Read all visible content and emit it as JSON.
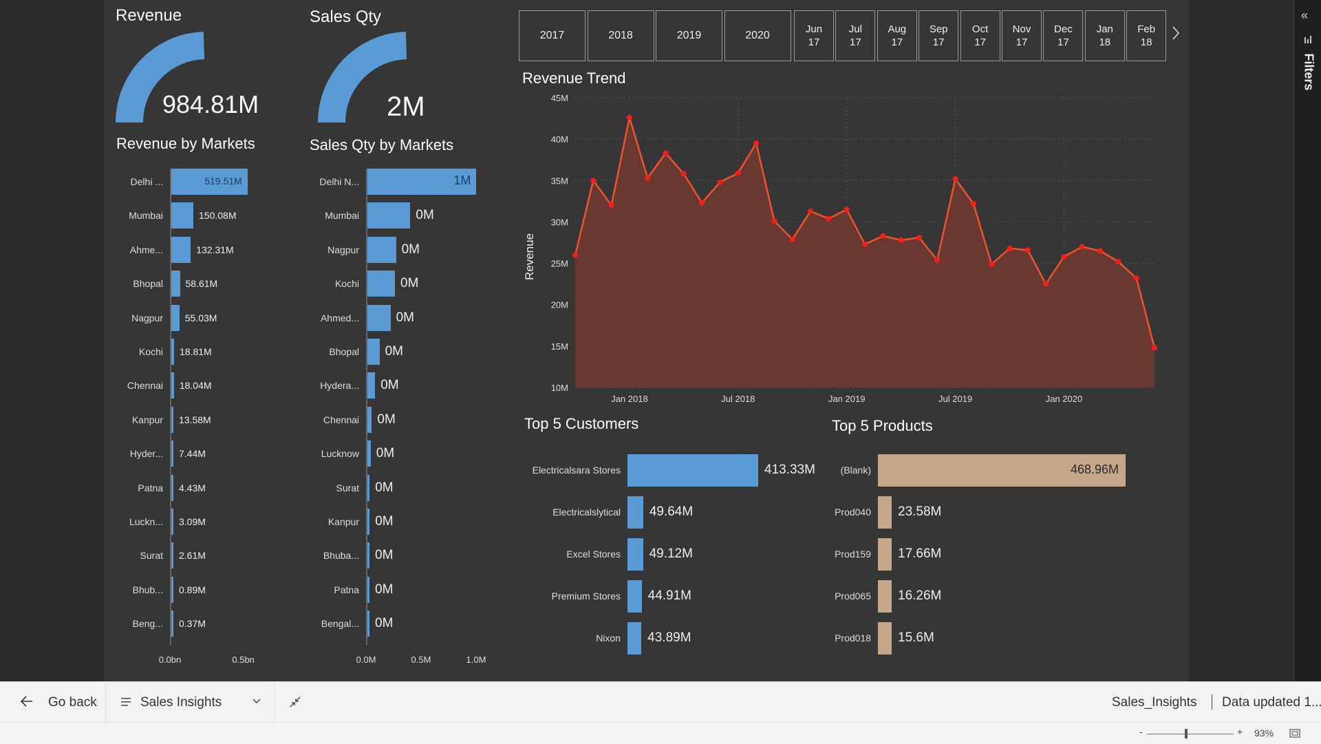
{
  "cards": {
    "revenue": {
      "title": "Revenue",
      "value": "984.81M",
      "fill": 0.98
    },
    "sales_qty": {
      "title": "Sales Qty",
      "value": "2M",
      "fill": 0.98
    }
  },
  "revenue_by_markets": {
    "title": "Revenue by Markets",
    "labels": [
      "Delhi ...",
      "Mumbai",
      "Ahme...",
      "Bhopal",
      "Nagpur",
      "Kochi",
      "Chennai",
      "Kanpur",
      "Hyder...",
      "Patna",
      "Luckn...",
      "Surat",
      "Bhub...",
      "Beng..."
    ],
    "value_labels": [
      "519.51M",
      "150.08M",
      "132.31M",
      "58.61M",
      "55.03M",
      "18.81M",
      "18.04M",
      "13.58M",
      "7.44M",
      "4.43M",
      "3.09M",
      "2.61M",
      "0.89M",
      "0.37M"
    ],
    "axis_ticks": [
      "0.0bn",
      "0.5bn"
    ]
  },
  "sales_qty_by_markets": {
    "title": "Sales Qty by Markets",
    "labels": [
      "Delhi N...",
      "Mumbai",
      "Nagpur",
      "Kochi",
      "Ahmed...",
      "Bhopal",
      "Hydera...",
      "Chennai",
      "Lucknow",
      "Surat",
      "Kanpur",
      "Bhuba...",
      "Patna",
      "Bengal..."
    ],
    "value_labels": [
      "1M",
      "0M",
      "0M",
      "0M",
      "0M",
      "0M",
      "0M",
      "0M",
      "0M",
      "0M",
      "0M",
      "0M",
      "0M",
      "0M"
    ],
    "axis_ticks": [
      "0.0M",
      "0.5M",
      "1.0M"
    ]
  },
  "slicer": {
    "years": [
      "2017",
      "2018",
      "2019",
      "2020"
    ],
    "months": [
      {
        "month": "Jun",
        "year": "17"
      },
      {
        "month": "Jul",
        "year": "17"
      },
      {
        "month": "Aug",
        "year": "17"
      },
      {
        "month": "Sep",
        "year": "17"
      },
      {
        "month": "Oct",
        "year": "17"
      },
      {
        "month": "Nov",
        "year": "17"
      },
      {
        "month": "Dec",
        "year": "17"
      },
      {
        "month": "Jan",
        "year": "18"
      },
      {
        "month": "Feb",
        "year": "18"
      }
    ],
    "next_icon": "chevron-right-icon"
  },
  "revenue_trend": {
    "title": "Revenue Trend",
    "ylabel": "Revenue",
    "y_ticks": [
      "45M",
      "40M",
      "35M",
      "30M",
      "25M",
      "20M",
      "15M",
      "10M"
    ],
    "x_ticks": [
      "Jan 2018",
      "Jul 2018",
      "Jan 2019",
      "Jul 2019",
      "Jan 2020"
    ]
  },
  "top_customers": {
    "title": "Top 5 Customers",
    "labels": [
      "Electricalsara Stores",
      "Electricalslytical",
      "Excel Stores",
      "Premium Stores",
      "Nixon"
    ],
    "value_labels": [
      "413.33M",
      "49.64M",
      "49.12M",
      "44.91M",
      "43.89M"
    ]
  },
  "top_products": {
    "title": "Top 5 Products",
    "labels": [
      "(Blank)",
      "Prod040",
      "Prod159",
      "Prod065",
      "Prod018"
    ],
    "value_labels": [
      "468.96M",
      "23.58M",
      "17.66M",
      "16.26M",
      "15.6M"
    ]
  },
  "filters_pane": {
    "label": "Filters",
    "collapse_icon": "double-chevron-left-icon",
    "filter_icon": "filter-icon"
  },
  "bottom_bar": {
    "go_back": "Go back",
    "report_name": "Sales Insights",
    "dataset": "Sales_Insights",
    "data_updated": "Data updated 1..."
  },
  "status_bar": {
    "zoom": "93%",
    "minus": "-",
    "plus": "+"
  },
  "colors": {
    "canvas": "#363636",
    "bar_blue": "#5b9bd5",
    "bar_tan": "#c4a788",
    "area_fill": "#6b3a30",
    "line": "#f0522c",
    "marker": "#ff1a1a"
  },
  "chart_data": [
    {
      "type": "bar",
      "title": "Revenue by Markets",
      "orientation": "horizontal",
      "categories": [
        "Delhi ...",
        "Mumbai",
        "Ahme...",
        "Bhopal",
        "Nagpur",
        "Kochi",
        "Chennai",
        "Kanpur",
        "Hyder...",
        "Patna",
        "Luckn...",
        "Surat",
        "Bhub...",
        "Beng..."
      ],
      "values": [
        519.51,
        150.08,
        132.31,
        58.61,
        55.03,
        18.81,
        18.04,
        13.58,
        7.44,
        4.43,
        3.09,
        2.61,
        0.89,
        0.37
      ],
      "unit": "M",
      "xlim": [
        0,
        600
      ]
    },
    {
      "type": "bar",
      "title": "Sales Qty by Markets",
      "orientation": "horizontal",
      "categories": [
        "Delhi N...",
        "Mumbai",
        "Nagpur",
        "Kochi",
        "Ahmed...",
        "Bhopal",
        "Hydera...",
        "Chennai",
        "Lucknow",
        "Surat",
        "Kanpur",
        "Bhuba...",
        "Patna",
        "Bengal..."
      ],
      "values": [
        0.99,
        0.39,
        0.26,
        0.25,
        0.21,
        0.11,
        0.07,
        0.04,
        0.03,
        0.02,
        0.02,
        0.01,
        0.01,
        0.01
      ],
      "unit": "M",
      "xlim": [
        0,
        1.0
      ]
    },
    {
      "type": "area",
      "title": "Revenue Trend",
      "ylabel": "Revenue",
      "x": [
        "2017-10",
        "2017-11",
        "2017-12",
        "2018-01",
        "2018-02",
        "2018-03",
        "2018-04",
        "2018-05",
        "2018-06",
        "2018-07",
        "2018-08",
        "2018-09",
        "2018-10",
        "2018-11",
        "2018-12",
        "2019-01",
        "2019-02",
        "2019-03",
        "2019-04",
        "2019-05",
        "2019-06",
        "2019-07",
        "2019-08",
        "2019-09",
        "2019-10",
        "2019-11",
        "2019-12",
        "2020-01",
        "2020-02",
        "2020-03",
        "2020-04",
        "2020-05",
        "2020-06"
      ],
      "values": [
        26.0,
        35.0,
        32.0,
        42.6,
        35.3,
        38.3,
        35.8,
        32.3,
        34.8,
        35.9,
        39.5,
        30.1,
        27.9,
        31.3,
        30.4,
        31.5,
        27.3,
        28.3,
        27.8,
        28.1,
        25.4,
        35.2,
        32.2,
        24.9,
        26.8,
        26.6,
        22.5,
        25.8,
        27.0,
        26.5,
        25.2,
        23.2,
        14.8
      ],
      "ylim": [
        10,
        45
      ],
      "x_ticks": [
        "Jan 2018",
        "Jul 2018",
        "Jan 2019",
        "Jul 2019",
        "Jan 2020"
      ]
    },
    {
      "type": "bar",
      "title": "Top 5 Customers",
      "orientation": "horizontal",
      "categories": [
        "Electricalsara Stores",
        "Electricalslytical",
        "Excel Stores",
        "Premium Stores",
        "Nixon"
      ],
      "values": [
        413.33,
        49.64,
        49.12,
        44.91,
        43.89
      ],
      "unit": "M"
    },
    {
      "type": "bar",
      "title": "Top 5 Products",
      "orientation": "horizontal",
      "categories": [
        "(Blank)",
        "Prod040",
        "Prod159",
        "Prod065",
        "Prod018"
      ],
      "values": [
        468.96,
        23.58,
        17.66,
        16.26,
        15.6
      ],
      "unit": "M"
    }
  ]
}
